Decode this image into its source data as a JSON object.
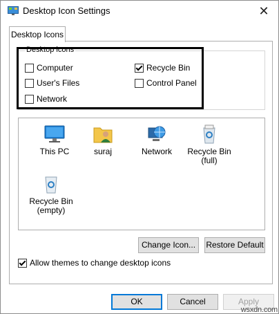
{
  "window": {
    "title": "Desktop Icon Settings",
    "close_glyph": "✕"
  },
  "tab": {
    "label": "Desktop Icons"
  },
  "group": {
    "legend": "Desktop icons",
    "options": [
      {
        "label": "Computer",
        "checked": false
      },
      {
        "label": "Recycle Bin",
        "checked": true
      },
      {
        "label": "User's Files",
        "checked": false
      },
      {
        "label": "Control Panel",
        "checked": false
      },
      {
        "label": "Network",
        "checked": false
      }
    ]
  },
  "icons": [
    {
      "label": "This PC",
      "icon": "monitor-icon"
    },
    {
      "label": "suraj",
      "icon": "user-folder-icon"
    },
    {
      "label": "Network",
      "icon": "network-globe-icon"
    },
    {
      "label": "Recycle Bin (full)",
      "icon": "recycle-bin-full-icon"
    },
    {
      "label": "Recycle Bin (empty)",
      "icon": "recycle-bin-empty-icon"
    }
  ],
  "buttons": {
    "change_icon": "Change Icon...",
    "restore_default": "Restore Default",
    "ok": "OK",
    "cancel": "Cancel",
    "apply": "Apply"
  },
  "allow_themes": {
    "label": "Allow themes to change desktop icons",
    "checked": true
  },
  "watermark": "wsxdn.com"
}
